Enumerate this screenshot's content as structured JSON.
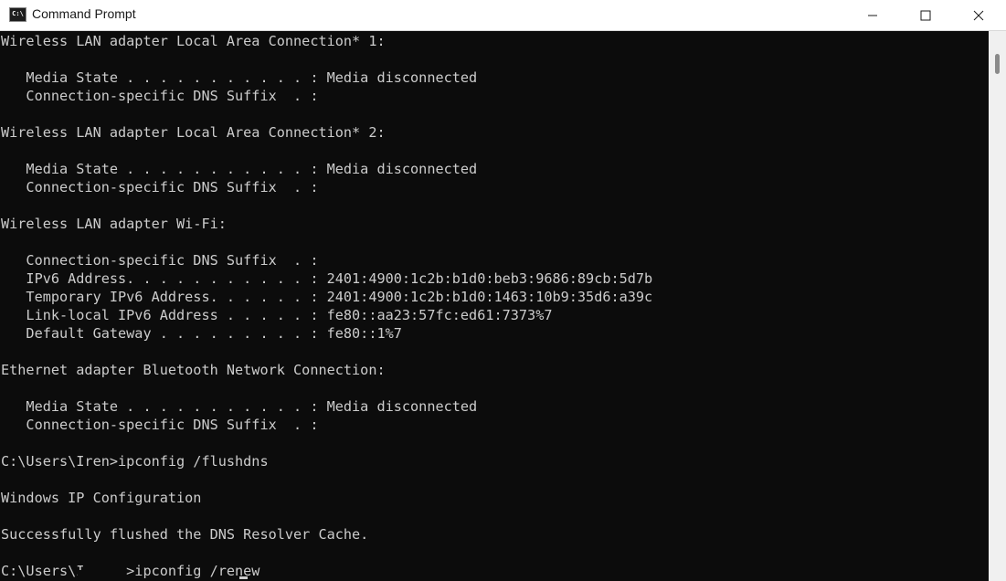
{
  "window": {
    "title": "Command Prompt",
    "icon": "cmd-icon",
    "icon_text": "C:\\",
    "controls": [
      "minimize-icon",
      "maximize-icon",
      "close-icon"
    ]
  },
  "terminal": {
    "background": "#0c0c0c",
    "foreground": "#cccccc",
    "lines": [
      "Wireless LAN adapter Local Area Connection* 1:",
      "",
      "   Media State . . . . . . . . . . . : Media disconnected",
      "   Connection-specific DNS Suffix  . :",
      "",
      "Wireless LAN adapter Local Area Connection* 2:",
      "",
      "   Media State . . . . . . . . . . . : Media disconnected",
      "   Connection-specific DNS Suffix  . :",
      "",
      "Wireless LAN adapter Wi-Fi:",
      "",
      "   Connection-specific DNS Suffix  . :",
      "   IPv6 Address. . . . . . . . . . . : 2401:4900:1c2b:b1d0:beb3:9686:89cb:5d7b",
      "   Temporary IPv6 Address. . . . . . : 2401:4900:1c2b:b1d0:1463:10b9:35d6:a39c",
      "   Link-local IPv6 Address . . . . . : fe80::aa23:57fc:ed61:7373%7",
      "   Default Gateway . . . . . . . . . : fe80::1%7",
      "",
      "Ethernet adapter Bluetooth Network Connection:",
      "",
      "   Media State . . . . . . . . . . . : Media disconnected",
      "   Connection-specific DNS Suffix  . :",
      "",
      "C:\\Users\\Iren>ipconfig /flushdns",
      "",
      "Windows IP Configuration",
      "",
      "Successfully flushed the DNS Resolver Cache.",
      "",
      "C:\\Users\\I     >ipconfig /renew"
    ]
  }
}
